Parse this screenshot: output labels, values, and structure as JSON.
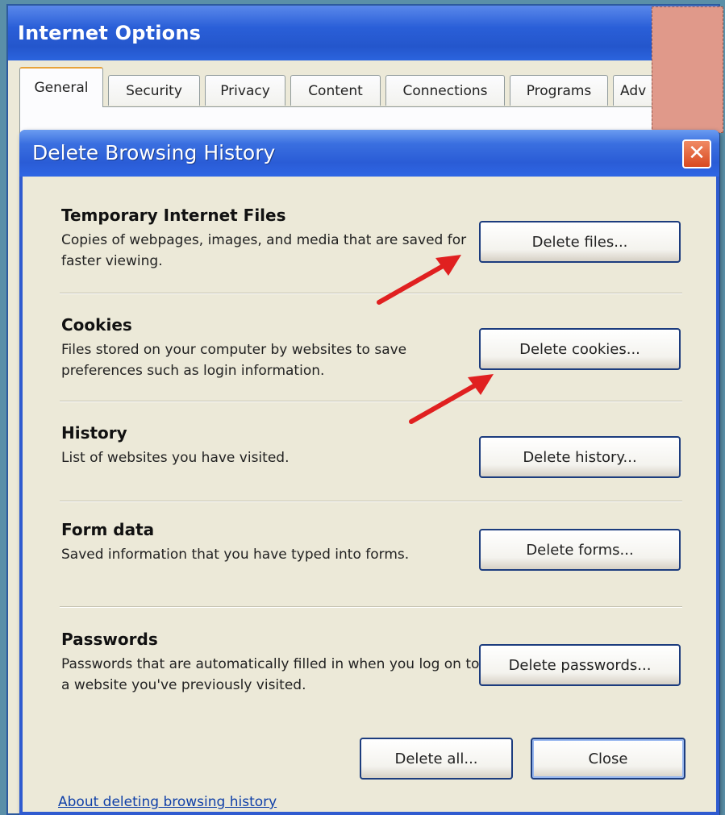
{
  "outer_window": {
    "title": "Internet Options",
    "tabs": [
      "General",
      "Security",
      "Privacy",
      "Content",
      "Connections",
      "Programs",
      "Adv"
    ]
  },
  "dialog": {
    "title": "Delete Browsing History",
    "close_glyph": "✕",
    "sections": [
      {
        "title": "Temporary Internet Files",
        "desc": "Copies of webpages, images, and media that are saved for faster viewing.",
        "button": "Delete files..."
      },
      {
        "title": "Cookies",
        "desc": "Files stored on your computer by websites to save preferences such as login information.",
        "button": "Delete cookies..."
      },
      {
        "title": "History",
        "desc": "List of websites you have visited.",
        "button": "Delete history..."
      },
      {
        "title": "Form data",
        "desc": "Saved information that you have typed into forms.",
        "button": "Delete forms..."
      },
      {
        "title": "Passwords",
        "desc": "Passwords that are automatically filled in when you log on to a website you've previously visited.",
        "button": "Delete passwords..."
      }
    ],
    "link": "About deleting browsing history",
    "delete_all_label": "Delete all...",
    "close_label": "Close"
  },
  "annotations": {
    "arrow_color": "#e02020",
    "arrow_icons": [
      "red-arrow-icon",
      "red-arrow-icon"
    ]
  }
}
